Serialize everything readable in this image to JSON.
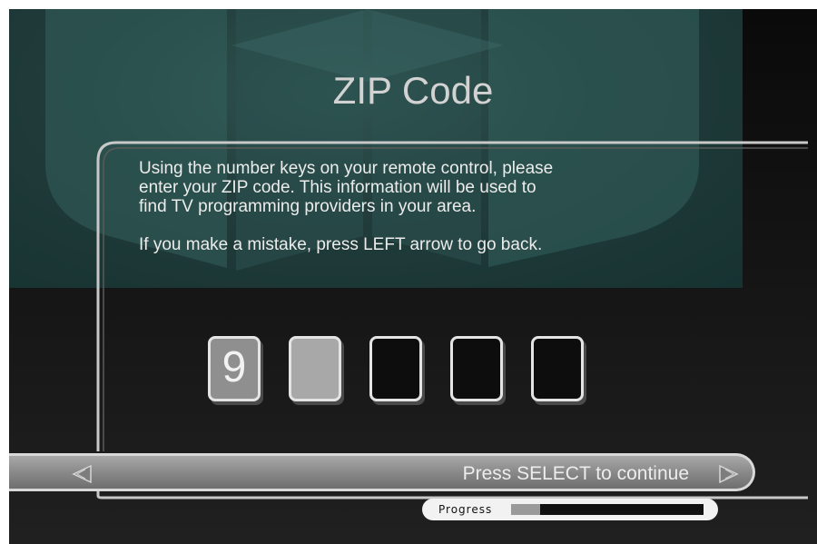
{
  "screen": {
    "title": "ZIP Code",
    "instructions": [
      "Using the number keys on your remote control, please",
      "enter your ZIP code.  This information will be used to",
      "find TV programming providers in your area."
    ],
    "mistake_hint": "If you make a mistake, press LEFT arrow to go back."
  },
  "zip_entry": {
    "digits": [
      "9",
      "",
      "",
      "",
      ""
    ],
    "active_index": 1
  },
  "nav": {
    "continue_label": "Press SELECT to continue",
    "left_arrow_icon": "left-arrow-icon",
    "right_arrow_icon": "right-arrow-icon"
  },
  "progress": {
    "label": "Progress",
    "fraction": 0.15
  },
  "colors": {
    "background": "#111111",
    "panel_tint": "#2a4a48",
    "text": "#ececec",
    "title": "#d2d2d2"
  }
}
